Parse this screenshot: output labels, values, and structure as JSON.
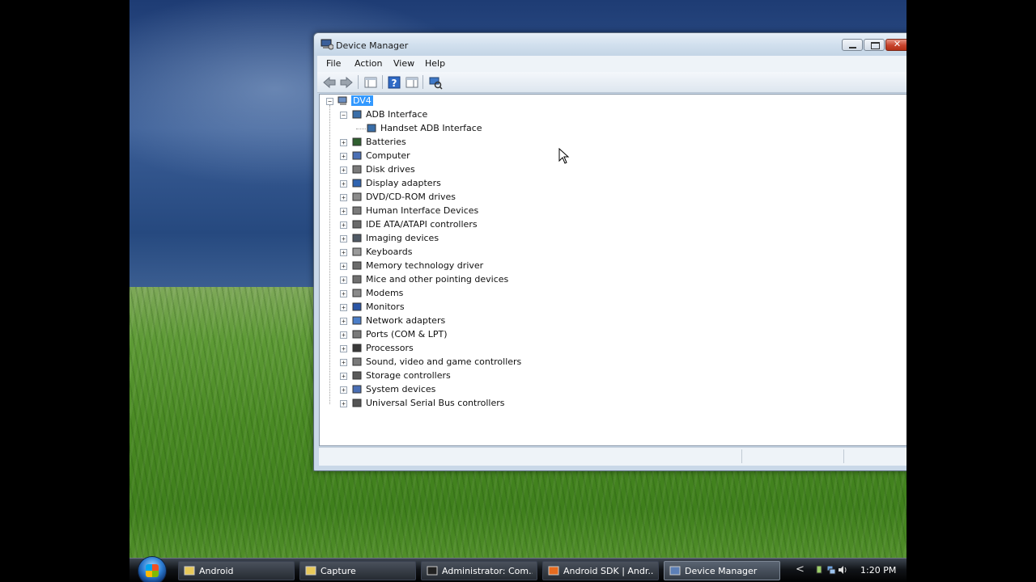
{
  "window": {
    "title": "Device Manager",
    "close_glyph": "✕"
  },
  "menu": [
    "File",
    "Action",
    "View",
    "Help"
  ],
  "toolbar": {
    "buttons": [
      "back-icon",
      "forward-icon",
      "properties-view-icon",
      "help-icon",
      "console-tree-icon",
      "scan-hardware-icon"
    ]
  },
  "tree": {
    "root": "DV4",
    "items": [
      {
        "label": "ADB Interface",
        "expanded": true,
        "children": [
          "Handset ADB Interface"
        ]
      },
      {
        "label": "Batteries"
      },
      {
        "label": "Computer"
      },
      {
        "label": "Disk drives"
      },
      {
        "label": "Display adapters"
      },
      {
        "label": "DVD/CD-ROM drives"
      },
      {
        "label": "Human Interface Devices"
      },
      {
        "label": "IDE ATA/ATAPI controllers"
      },
      {
        "label": "Imaging devices"
      },
      {
        "label": "Keyboards"
      },
      {
        "label": "Memory technology driver"
      },
      {
        "label": "Mice and other pointing devices"
      },
      {
        "label": "Modems"
      },
      {
        "label": "Monitors"
      },
      {
        "label": "Network adapters"
      },
      {
        "label": "Ports (COM & LPT)"
      },
      {
        "label": "Processors"
      },
      {
        "label": "Sound, video and game controllers"
      },
      {
        "label": "Storage controllers"
      },
      {
        "label": "System devices"
      },
      {
        "label": "Universal Serial Bus controllers"
      }
    ]
  },
  "taskbar": {
    "items": [
      {
        "label": "Android",
        "icon": "folder-icon"
      },
      {
        "label": "Capture",
        "icon": "folder-icon"
      },
      {
        "label": "Administrator: Com...",
        "icon": "cmd-icon"
      },
      {
        "label": "Android SDK | Andr...",
        "icon": "firefox-icon"
      },
      {
        "label": "Device Manager",
        "icon": "device-manager-icon",
        "active": true
      }
    ],
    "tray_arrow": "<",
    "clock": "1:20 PM"
  }
}
